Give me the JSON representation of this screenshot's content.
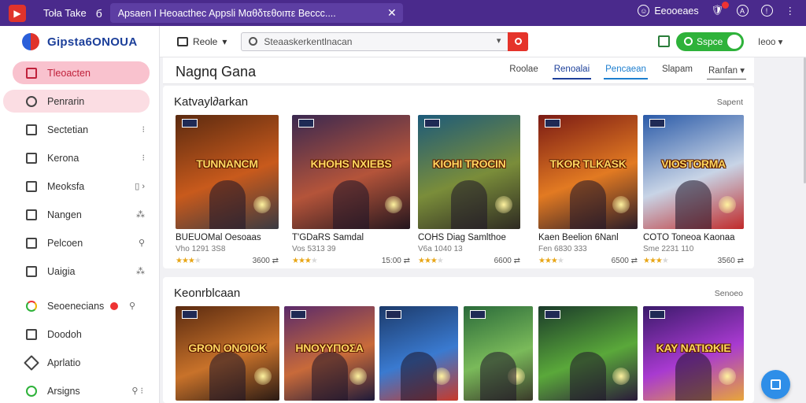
{
  "browser": {
    "title": "Toła Take",
    "sep": "б",
    "tab": "Apsaen  Ι Heoacthec Appsli  Μαθδτεθοιπε Beccc....",
    "user": "Eeooeaes"
  },
  "brand": {
    "name": "Gipsta6ONOUA"
  },
  "sidebar": {
    "items": [
      {
        "label": "Tleoacten",
        "trail": ""
      },
      {
        "label": "Penrarin",
        "trail": ""
      },
      {
        "label": "Sectetian",
        "trail": "⁝"
      },
      {
        "label": "Kerona",
        "trail": "⁝"
      },
      {
        "label": "Meoksfa",
        "trail": "▯ ›"
      },
      {
        "label": "Nangen",
        "trail": "⁂"
      },
      {
        "label": "Pelcoen",
        "trail": "⚲"
      },
      {
        "label": "Uaigia",
        "trail": "⁂"
      },
      {
        "label": "Seoenecians",
        "trail": "⚲"
      },
      {
        "label": "Doodoh",
        "trail": ""
      },
      {
        "label": "Aprlatio",
        "trail": ""
      },
      {
        "label": "Arsigns",
        "trail": "⚲ ⁝"
      }
    ]
  },
  "toolbar": {
    "view_label": "Reole",
    "search_value": "Steaaskerkentlnacan",
    "sync_label": "Sspce",
    "more_label": "Ieoo"
  },
  "page": {
    "title": "Nagnq Gana",
    "tabs": [
      "Roolae",
      "Renoalai",
      "Pencaean",
      "Slapam",
      "Ranfan"
    ]
  },
  "sections": [
    {
      "title": "Katvayl∂arkan",
      "link": "Sapent",
      "cards": [
        {
          "logo": "TUNNANCM",
          "name": "BUEUOMal Oesoaas",
          "sub": "Vho 1291 3S8",
          "rating": 3,
          "price": "3600 ⇄",
          "colors": [
            "#5b2a10",
            "#c85a1c",
            "#3a3a42"
          ]
        },
        {
          "logo": "KHOHS NXIEBS",
          "name": "T'GDaRS Samdal",
          "sub": "Vos 5313 39",
          "rating": 3,
          "price": "15:00 ⇄",
          "colors": [
            "#3a2850",
            "#b4543a",
            "#24161e"
          ]
        },
        {
          "logo": "KIOHI TROCIN",
          "name": "COHS Diag Samlthoe",
          "sub": "V6a 1040 13",
          "rating": 3,
          "price": "6600 ⇄",
          "colors": [
            "#1c5a7a",
            "#7a8d3a",
            "#2e2a22"
          ]
        },
        {
          "logo": "TKOR TLKASK",
          "name": "Kaen Beelion 6Nanl",
          "sub": "Fen 6830 333",
          "rating": 3,
          "price": "6500 ⇄",
          "colors": [
            "#7a1a14",
            "#e27a22",
            "#2a1c28"
          ]
        },
        {
          "logo": "VIOSTORMA",
          "name": "COTO Toneoa Kaonaa",
          "sub": "Sme 2231 110",
          "rating": 3,
          "price": "3560 ⇄",
          "colors": [
            "#2a5aa8",
            "#c8d4e6",
            "#c02a2a"
          ]
        }
      ]
    },
    {
      "title": "Keonrblcaan",
      "link": "Senoeo",
      "cards": [
        {
          "logo": "GRON ΟΝΟΙΟΚ",
          "name": "",
          "sub": "",
          "rating": 0,
          "price": "",
          "colors": [
            "#5a2a10",
            "#c8722a",
            "#2a1a14"
          ]
        },
        {
          "logo": "ΗΝΟΥΥΠΟΣΑ",
          "name": "",
          "sub": "",
          "rating": 0,
          "price": "",
          "colors": [
            "#5a2a6a",
            "#c86a3a",
            "#1e1a3a"
          ]
        },
        {
          "logo": "",
          "name": "",
          "sub": "",
          "rating": 0,
          "price": "",
          "colors": [
            "#1c3a6a",
            "#3a7ad0",
            "#c83a2a"
          ]
        },
        {
          "logo": "",
          "name": "",
          "sub": "",
          "rating": 0,
          "price": "",
          "colors": [
            "#2a6a3a",
            "#7aba5a",
            "#3a3a2a"
          ]
        },
        {
          "logo": "",
          "name": "",
          "sub": "",
          "rating": 0,
          "price": "",
          "colors": [
            "#1a3a2a",
            "#5aa83a",
            "#2a1a3a"
          ]
        },
        {
          "logo": "KΑΥ ΝΑΤΙΩΚΙΕ",
          "name": "",
          "sub": "",
          "rating": 0,
          "price": "",
          "colors": [
            "#3a1a6a",
            "#a83ad0",
            "#e8a63a"
          ]
        }
      ]
    }
  ]
}
